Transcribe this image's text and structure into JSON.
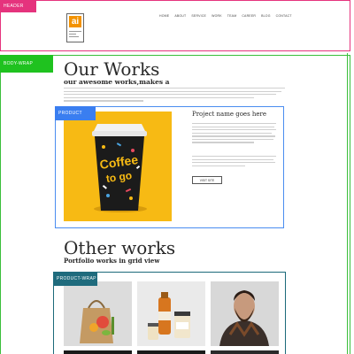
{
  "overlay_labels": {
    "header": "HEADER",
    "body_wrap": "BODY-WRAP",
    "product": "PRODUCT",
    "product_wrap": "PRODUCT-WRAP"
  },
  "colors": {
    "header": "#e5337d",
    "body_wrap": "#1fc21f",
    "product": "#3a7ef0",
    "product_wrap": "#1f6b7d",
    "logo": "#f39200",
    "cup_background": "#f7ba14"
  },
  "header": {
    "logo_text": "ai",
    "nav": [
      "HOME",
      "ABOUT",
      "SERVICE",
      "WORK",
      "TEAM",
      "CAREER",
      "BLOG",
      "CONTACT"
    ]
  },
  "our_works": {
    "title": "Our Works",
    "subtitle": "our awesome works,makes a"
  },
  "product": {
    "image_icon": "coffee-cup-image",
    "cup_text": "Coffee to go",
    "title": "Project name goes here",
    "button": "VISIT SITE"
  },
  "other_works": {
    "title": "Other works",
    "subtitle": "Portfolio works in grid view",
    "tiles": [
      {
        "icon": "paper-bag-image"
      },
      {
        "icon": "jars-image"
      },
      {
        "icon": "bearded-man-image"
      }
    ]
  }
}
